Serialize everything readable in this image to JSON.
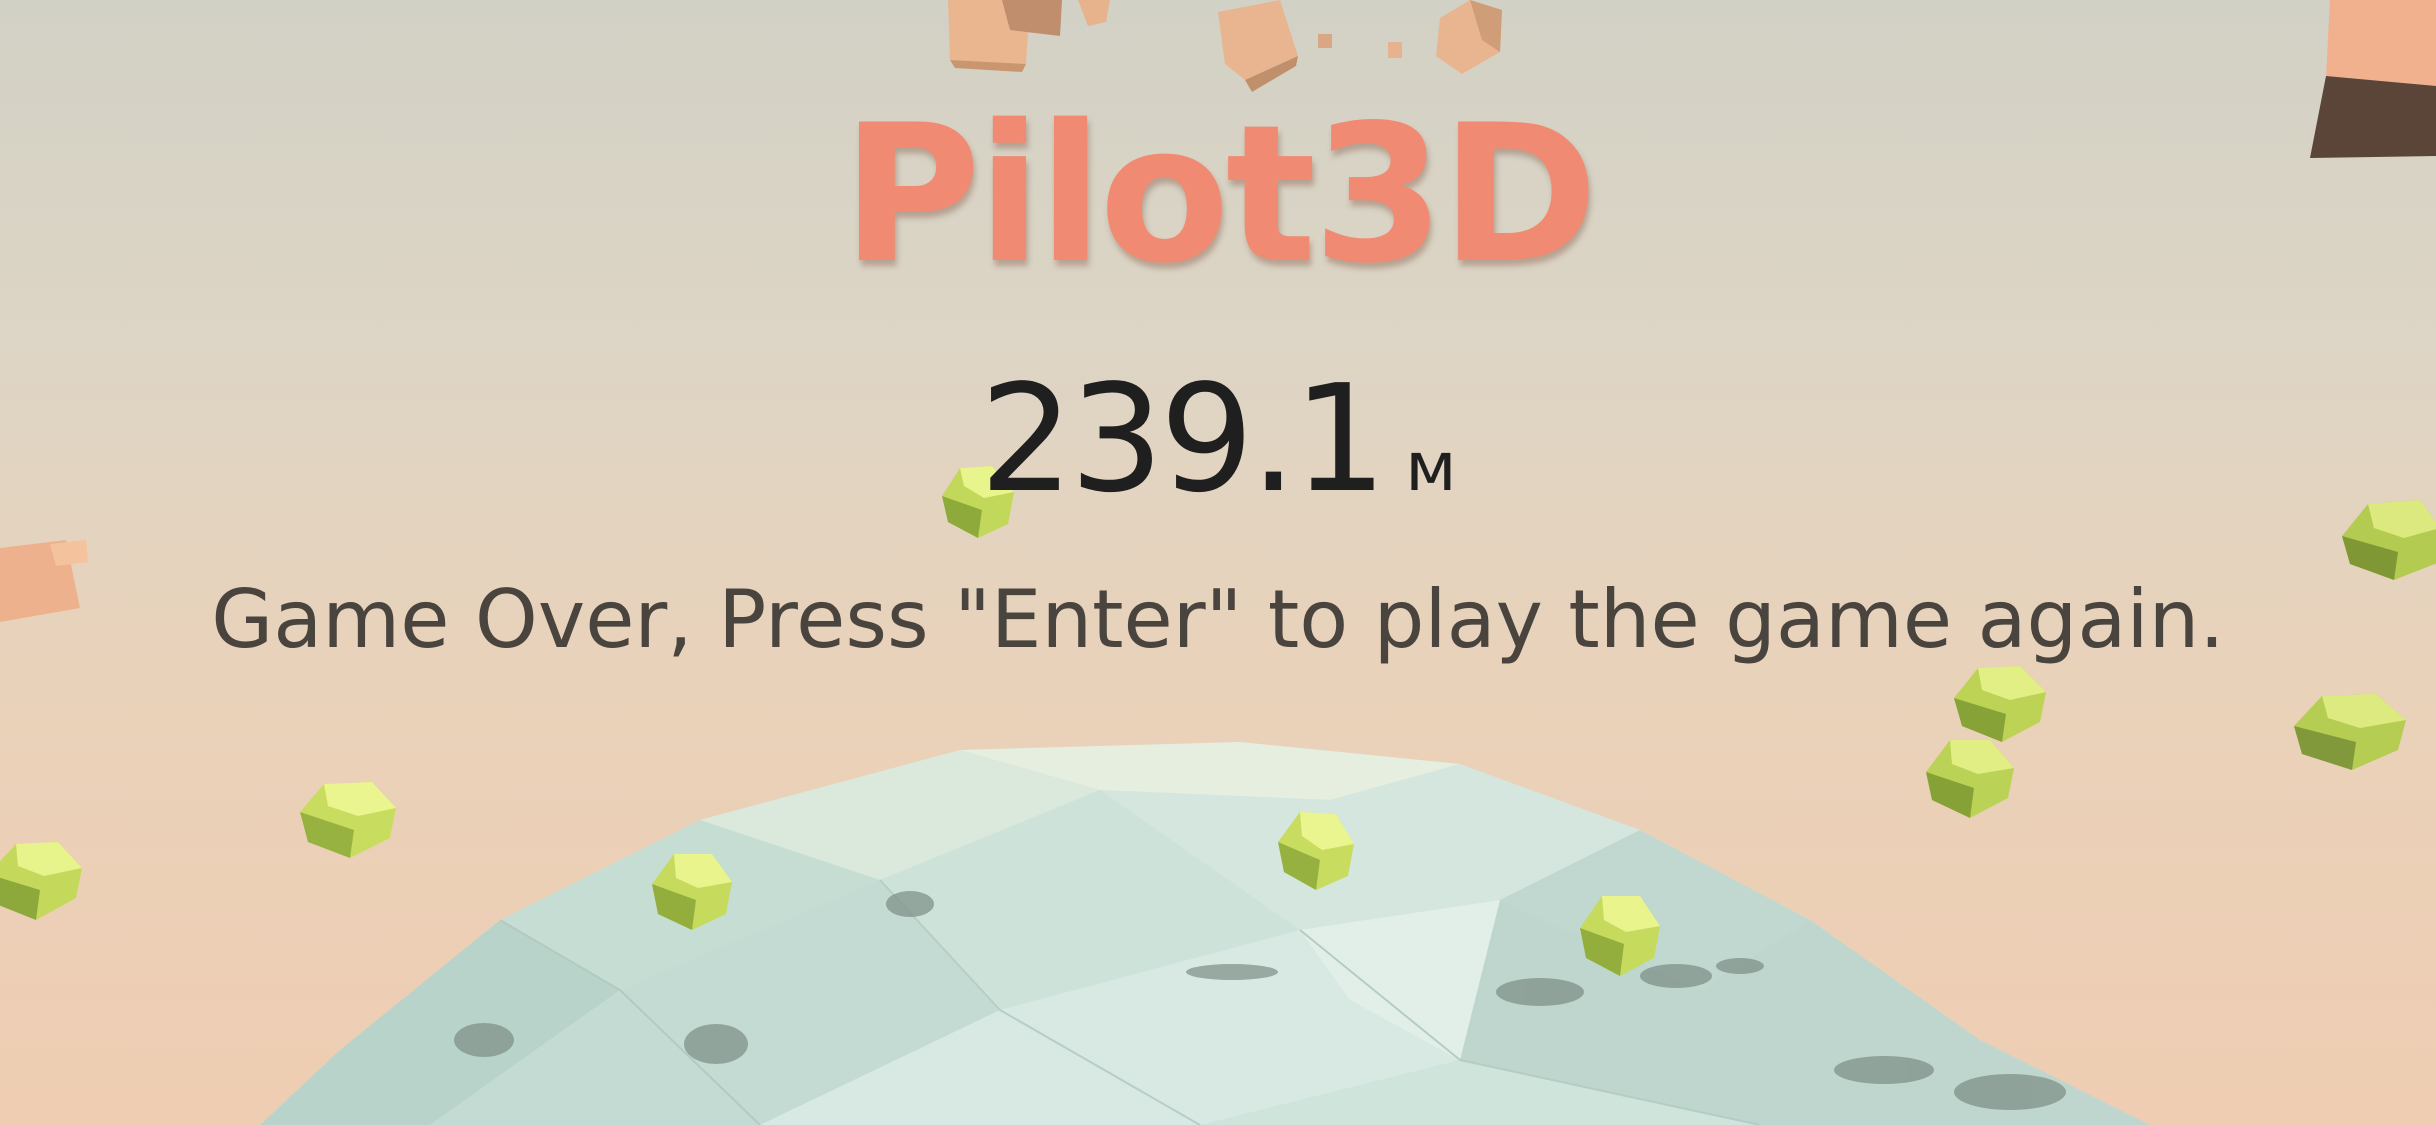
{
  "game": {
    "title": "Pilot3D",
    "distance_value": "239.1",
    "distance_unit": "м",
    "message": "Game Over, Press \"Enter\" to play the game again."
  },
  "colors": {
    "title": "#f08a72",
    "score_text": "#1f1f1f",
    "message_text": "#4a443f",
    "sky_top": "#d2d1c5",
    "sky_bottom": "#efcdb2",
    "planet": "#cfe4da",
    "coin": "#d6ea6a",
    "cloud_block": "#eeb48e"
  },
  "scene": {
    "planet": "low-poly-sea-planet",
    "collectibles": "green-low-poly-coins",
    "obstacles": "orange-cube-clouds"
  }
}
